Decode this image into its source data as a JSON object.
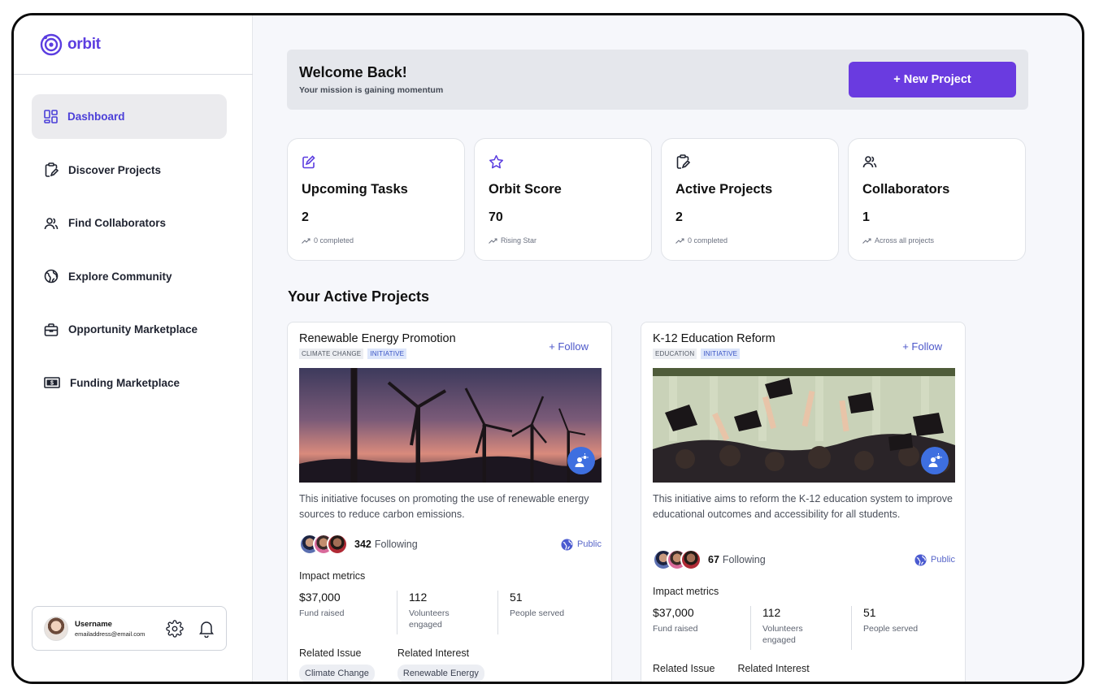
{
  "brand": {
    "name": "orbit",
    "color": "#5b3de0"
  },
  "sidebar": {
    "items": [
      {
        "label": "Dashboard",
        "icon": "dashboard-icon",
        "active": true
      },
      {
        "label": "Discover Projects",
        "icon": "clipboard-edit-icon"
      },
      {
        "label": "Find Collaborators",
        "icon": "users-icon"
      },
      {
        "label": "Explore Community",
        "icon": "globe-icon"
      },
      {
        "label": "Opportunity Marketplace",
        "icon": "briefcase-icon"
      },
      {
        "label": "Funding Marketplace",
        "icon": "money-icon"
      }
    ],
    "user": {
      "name": "Username",
      "email": "emailaddress@email.com"
    }
  },
  "welcome": {
    "title": "Welcome Back!",
    "subtitle": "Your mission is gaining momentum",
    "button": "+ New Project"
  },
  "stats": [
    {
      "icon": "edit-icon",
      "title": "Upcoming Tasks",
      "value": "2",
      "note": "0 completed"
    },
    {
      "icon": "star-icon",
      "title": "Orbit Score",
      "value": "70",
      "note": "Rising Star"
    },
    {
      "icon": "clipboard-edit-icon",
      "title": "Active Projects",
      "value": "2",
      "note": "0 completed"
    },
    {
      "icon": "users-icon",
      "title": "Collaborators",
      "value": "1",
      "note": "Across all projects"
    }
  ],
  "section_title": "Your Active Projects",
  "projects": [
    {
      "name": "Renewable Energy Promotion",
      "tags": [
        "CLIMATE CHANGE",
        "INITIATIVE"
      ],
      "follow": "+ Follow",
      "description": "This initiative focuses on promoting the use of renewable energy sources to reduce carbon emissions.",
      "following_count": "342",
      "following_label": "Following",
      "visibility": "Public",
      "metrics_title": "Impact metrics",
      "metrics": [
        {
          "value": "$37,000",
          "label": "Fund raised"
        },
        {
          "value": "112",
          "label": "Volunteers engaged"
        },
        {
          "value": "51",
          "label": "People served"
        }
      ],
      "related_issue_title": "Related Issue",
      "related_issue": "Climate Change",
      "related_interest_title": "Related Interest",
      "related_interest": "Renewable Energy"
    },
    {
      "name": "K-12 Education Reform",
      "tags": [
        "EDUCATION",
        "INITIATIVE"
      ],
      "follow": "+ Follow",
      "description": "This initiative aims to reform the K-12 education system to improve educational outcomes and accessibility for all students.",
      "following_count": "67",
      "following_label": "Following",
      "visibility": "Public",
      "metrics_title": "Impact metrics",
      "metrics": [
        {
          "value": "$37,000",
          "label": "Fund raised"
        },
        {
          "value": "112",
          "label": "Volunteers engaged"
        },
        {
          "value": "51",
          "label": "People served"
        }
      ],
      "related_issue_title": "Related Issue",
      "related_interest_title": "Related Interest"
    }
  ]
}
